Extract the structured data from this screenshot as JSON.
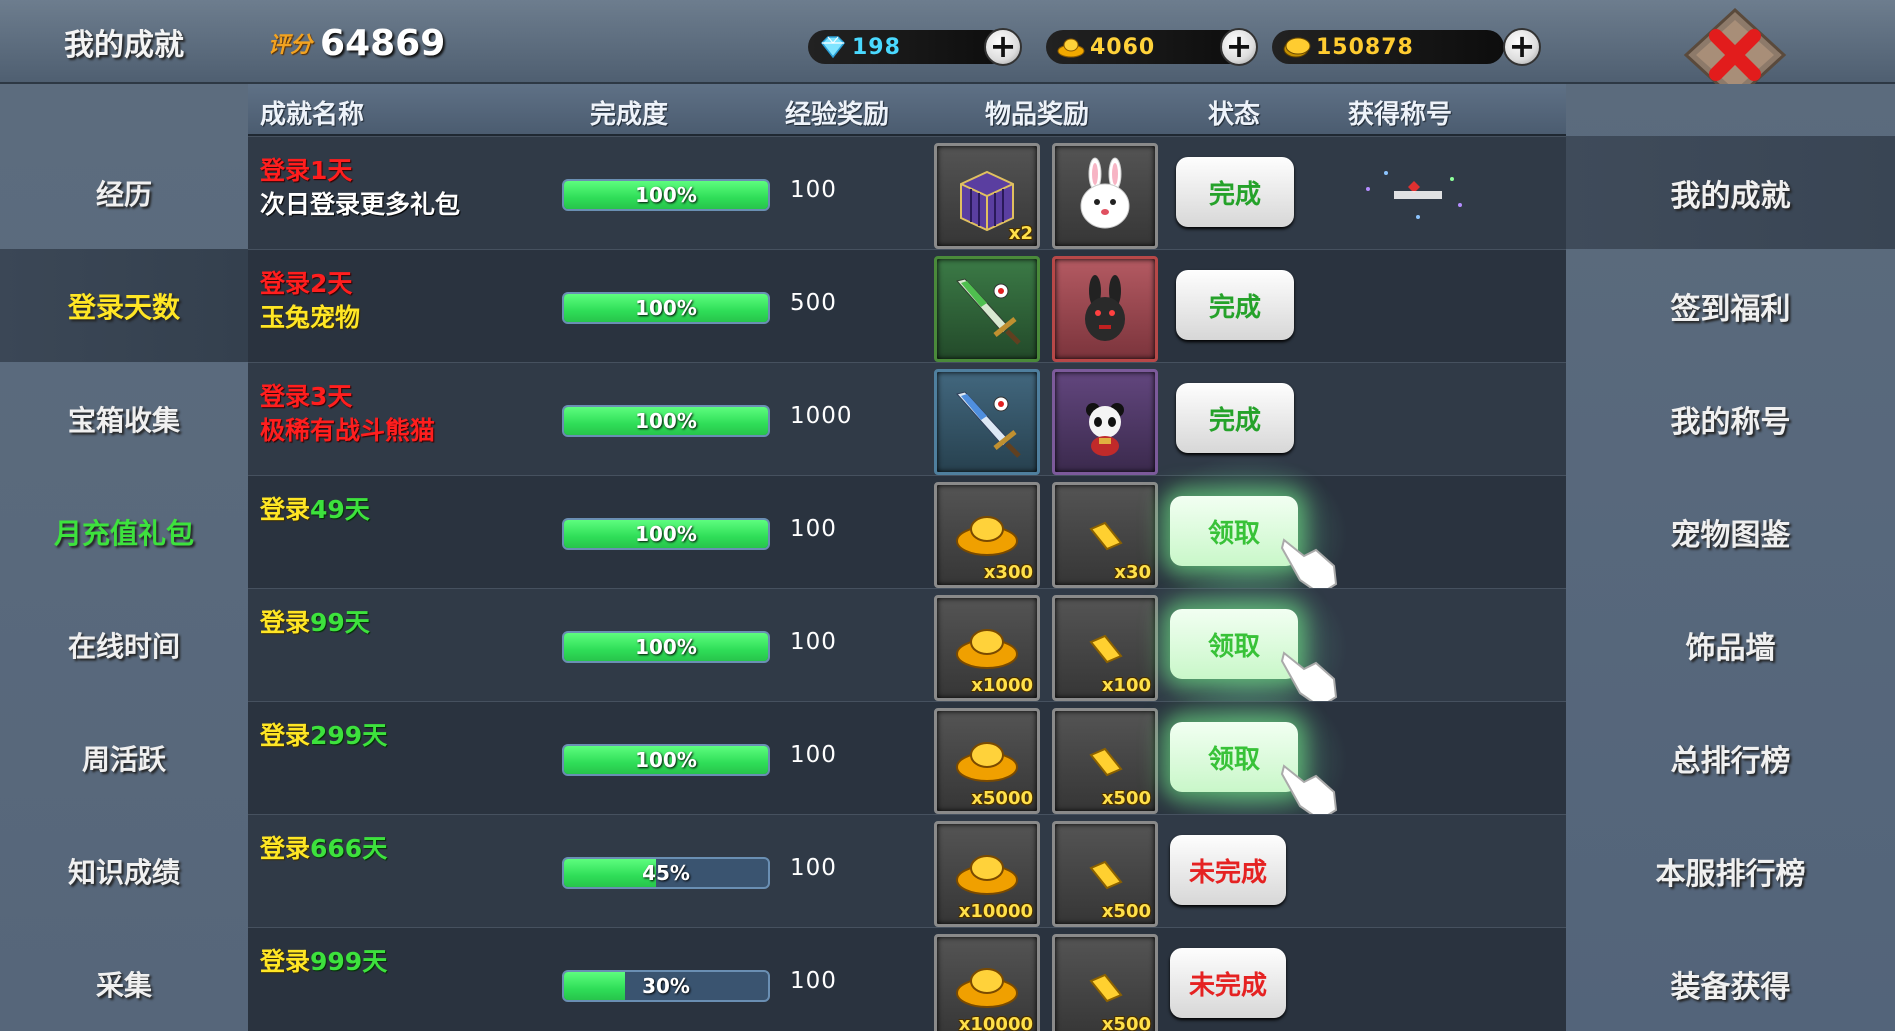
{
  "header": {
    "title": "我的成就",
    "score_label": "评分",
    "score_value": "64869",
    "diamonds": "198",
    "ingots": "4060",
    "coins": "150878"
  },
  "columns": {
    "name": "成就名称",
    "progress": "完成度",
    "exp": "经验奖励",
    "items": "物品奖励",
    "status": "状态",
    "title": "获得称号"
  },
  "left_menu": [
    {
      "label": "经历"
    },
    {
      "label": "登录天数"
    },
    {
      "label": "宝箱收集"
    },
    {
      "label": "月充值礼包"
    },
    {
      "label": "在线时间"
    },
    {
      "label": "周活跃"
    },
    {
      "label": "知识成绩"
    },
    {
      "label": "采集"
    }
  ],
  "right_menu": [
    {
      "label": "我的成就"
    },
    {
      "label": "签到福利"
    },
    {
      "label": "我的称号"
    },
    {
      "label": "宠物图鉴"
    },
    {
      "label": "饰品墙"
    },
    {
      "label": "总排行榜"
    },
    {
      "label": "本服排行榜"
    },
    {
      "label": "装备获得"
    }
  ],
  "rows": [
    {
      "name_prefix": "登录",
      "name_days": "1天",
      "name_sub": "次日登录更多礼包",
      "progress": 100,
      "progress_text": "100%",
      "exp": "100",
      "item1_qty": "x2",
      "item2_qty": "",
      "status": "完成"
    },
    {
      "name_prefix": "登录",
      "name_days": "2天",
      "name_sub": "玉兔宠物",
      "progress": 100,
      "progress_text": "100%",
      "exp": "500",
      "item1_qty": "",
      "item2_qty": "",
      "status": "完成"
    },
    {
      "name_prefix": "登录",
      "name_days": "3天",
      "name_sub": "极稀有战斗熊猫",
      "progress": 100,
      "progress_text": "100%",
      "exp": "1000",
      "item1_qty": "",
      "item2_qty": "",
      "status": "完成"
    },
    {
      "name_prefix": "登录",
      "name_days": "49天",
      "name_sub": "",
      "progress": 100,
      "progress_text": "100%",
      "exp": "100",
      "item1_qty": "x300",
      "item2_qty": "x30",
      "status": "领取"
    },
    {
      "name_prefix": "登录",
      "name_days": "99天",
      "name_sub": "",
      "progress": 100,
      "progress_text": "100%",
      "exp": "100",
      "item1_qty": "x1000",
      "item2_qty": "x100",
      "status": "领取"
    },
    {
      "name_prefix": "登录",
      "name_days": "299天",
      "name_sub": "",
      "progress": 100,
      "progress_text": "100%",
      "exp": "100",
      "item1_qty": "x5000",
      "item2_qty": "x500",
      "status": "领取"
    },
    {
      "name_prefix": "登录",
      "name_days": "666天",
      "name_sub": "",
      "progress": 45,
      "progress_text": "45%",
      "exp": "100",
      "item1_qty": "x10000",
      "item2_qty": "x500",
      "status": "未完成"
    },
    {
      "name_prefix": "登录",
      "name_days": "999天",
      "name_sub": "",
      "progress": 30,
      "progress_text": "30%",
      "exp": "100",
      "item1_qty": "x10000",
      "item2_qty": "x500",
      "status": "未完成"
    }
  ],
  "colors": {
    "progress_fill": "#2fde58",
    "done_text": "#25a22a",
    "undone_text": "#e52222",
    "active_menu_text": "#ffe625",
    "highlight_menu_text": "#3de23d"
  }
}
